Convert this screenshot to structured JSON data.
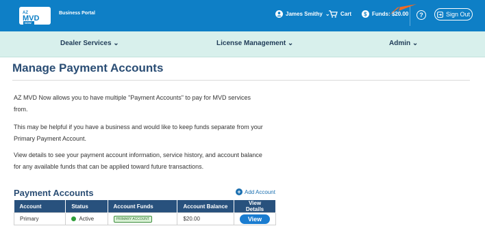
{
  "header": {
    "logo_text": "AZ MVD NOW",
    "portal_label": "Business Portal",
    "user_name": "James Smithy",
    "cart_label": "Cart",
    "funds_label": "Funds: $20.00",
    "help_symbol": "?",
    "signout_label": "Sign Out"
  },
  "nav": {
    "items": [
      {
        "label": "Dealer Services ⌄"
      },
      {
        "label": "License Management ⌄"
      },
      {
        "label": "Admin ⌄"
      }
    ]
  },
  "main": {
    "title": "Manage Payment Accounts",
    "paragraphs": [
      "AZ MVD Now allows you to have multiple \"Payment Accounts\" to pay for MVD services from.",
      "This may be helpful if you have a business and would like to keep funds separate from your Primary Payment Account.",
      "View details to see your payment account information, service history, and account balance for any available funds that can be applied toward future transactions."
    ],
    "section_title": "Payment Accounts",
    "add_account_label": "Add Account",
    "table": {
      "headers": [
        "Account",
        "Status",
        "Account Funds",
        "Account Balance",
        "View Details"
      ],
      "rows": [
        {
          "account": "Primary",
          "status": "Active",
          "funds_badge": "PRIMARY ACCOUNT",
          "balance": "$20.00",
          "view_label": "View"
        }
      ]
    }
  },
  "colors": {
    "header_bg": "#0e7fc6",
    "nav_bg": "#d8f0ec",
    "title_color": "#2a4d74",
    "table_header_bg": "#28517d",
    "active_green": "#2e9e3a",
    "button_blue": "#1a7cd0",
    "arrow_orange": "#f06a22"
  },
  "icons": {
    "user": "user-circle-icon",
    "cart": "cart-icon",
    "funds": "dollar-circle-icon",
    "help": "help-circle-icon",
    "signout": "sign-out-icon",
    "add": "plus-circle-icon",
    "arrow": "orange-arrow-indicator"
  }
}
